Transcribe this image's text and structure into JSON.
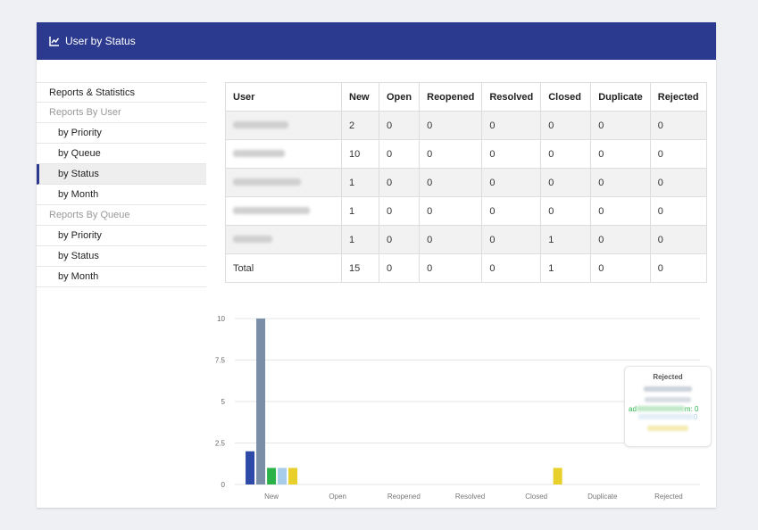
{
  "header": {
    "title": "User by Status",
    "icon": "line-chart-icon"
  },
  "nav": {
    "top": "Reports & Statistics",
    "groups": [
      {
        "label": "Reports By User",
        "items": [
          "by Priority",
          "by Queue",
          "by Status",
          "by Month"
        ],
        "active": 2
      },
      {
        "label": "Reports By Queue",
        "items": [
          "by Priority",
          "by Status",
          "by Month"
        ]
      }
    ]
  },
  "table": {
    "headers": [
      "User",
      "New",
      "Open",
      "Reopened",
      "Resolved",
      "Closed",
      "Duplicate",
      "Rejected"
    ],
    "rows": [
      [
        "2",
        "0",
        "0",
        "0",
        "0",
        "0",
        "0"
      ],
      [
        "10",
        "0",
        "0",
        "0",
        "0",
        "0",
        "0"
      ],
      [
        "1",
        "0",
        "0",
        "0",
        "0",
        "0",
        "0"
      ],
      [
        "1",
        "0",
        "0",
        "0",
        "0",
        "0",
        "0"
      ],
      [
        "1",
        "0",
        "0",
        "0",
        "1",
        "0",
        "0"
      ]
    ],
    "total_label": "Total",
    "totals": [
      "15",
      "0",
      "0",
      "0",
      "1",
      "0",
      "0"
    ]
  },
  "chart_data": {
    "type": "bar",
    "categories": [
      "New",
      "Open",
      "Reopened",
      "Resolved",
      "Closed",
      "Duplicate",
      "Rejected"
    ],
    "series": [
      {
        "values": [
          2,
          0,
          0,
          0,
          0,
          0,
          0
        ],
        "color": "#2e4aa8"
      },
      {
        "values": [
          10,
          0,
          0,
          0,
          0,
          0,
          0
        ],
        "color": "#7b8ea8"
      },
      {
        "values": [
          1,
          0,
          0,
          0,
          0,
          0,
          0
        ],
        "color": "#2bb34a"
      },
      {
        "values": [
          1,
          0,
          0,
          0,
          0,
          0,
          0
        ],
        "color": "#a8cdea"
      },
      {
        "values": [
          1,
          0,
          0,
          0,
          1,
          0,
          0
        ],
        "color": "#e8cf2a"
      }
    ],
    "ylim": [
      0,
      10
    ],
    "yticks": [
      "0",
      "2.5",
      "5",
      "7.5",
      "10"
    ],
    "grid": true
  },
  "tooltip": {
    "title": "Rejected",
    "fragment": "ad",
    "fragment_tail": "m: 0",
    "fragment_zero": "0"
  }
}
